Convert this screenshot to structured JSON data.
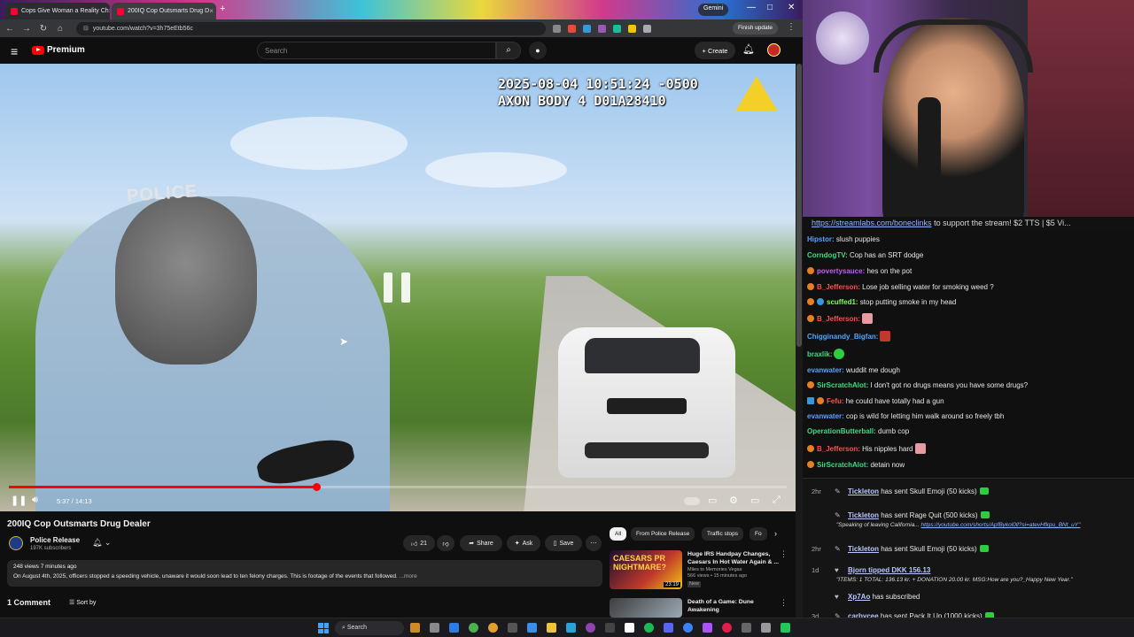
{
  "browser": {
    "tabs": [
      {
        "label": "Cops Give Woman a Reality Ch",
        "close": "×"
      },
      {
        "label": "200IQ Cop Outsmarts Drug D",
        "close": "×"
      }
    ],
    "new_tab": "+",
    "gemini_label": "Gemini",
    "url": "youtube.com/watch?v=3h75eEtb56c",
    "finish_update": "Finish update",
    "window_controls": [
      "—",
      "□",
      "✕"
    ]
  },
  "youtube": {
    "logo_word": "Premium",
    "search_placeholder": "Search",
    "create_label": "+ Create",
    "video": {
      "overlay_line1": "2025-08-04 10:51:24 -0500",
      "overlay_line2": "AXON BODY 4 D01A28410",
      "police_patch": "POLICE",
      "time": "5:37 / 14:13",
      "progress_fraction": 0.395
    },
    "title": "200IQ Cop Outsmarts Drug Dealer",
    "channel": {
      "name": "Police Release",
      "subs": "197K subscribers"
    },
    "actions": {
      "likes": "21",
      "share": "Share",
      "ask": "Ask",
      "save": "Save"
    },
    "description": {
      "meta": "248 views  7 minutes ago",
      "text": "On August 4th, 2025, officers stopped a speeding vehicle, unaware it would soon lead to ten felony charges. This is footage of the events that followed.",
      "more": "...more"
    },
    "comments_count": "1 Comment",
    "sort_by": "Sort by",
    "chips": [
      "All",
      "From Police Release",
      "Traffic stops",
      "Fo"
    ],
    "recommendations": [
      {
        "title": "Huge IRS Handpay Changes, Caesars In Hot Water Again & ...",
        "channel": "Miles to Memories Vegas",
        "meta": "566 views • 15 minutes ago",
        "badge": "New",
        "duration": "23:19",
        "thumb_text": "CAESARS PR NIGHTMARE?"
      },
      {
        "title": "Death of a Game: Dune Awakening",
        "channel": "",
        "meta": "",
        "badge": "",
        "duration": "",
        "thumb_text": ""
      }
    ]
  },
  "stream": {
    "ticker_link": "https://streamlabs.com/boneclinks",
    "ticker_text": " to support the stream! $2 TTS | $5 Vi...",
    "chat": [
      {
        "user": "Hipstor:",
        "text": " slush puppies",
        "color": "#5aa0ff"
      },
      {
        "user": "CorndogTV:",
        "text": " Cop has an SRT dodge",
        "color": "#3ddc84"
      },
      {
        "user": "povertysauce:",
        "text": " hes on the pot",
        "color": "#c45cff"
      },
      {
        "user": "B_Jefferson:",
        "text": " Lose job selling water for smoking weed ?",
        "color": "#ff4d4d"
      },
      {
        "user": "scuffed1:",
        "text": " stop putting smoke in my head",
        "color": "#7cff5a"
      },
      {
        "user": "B_Jefferson:",
        "text": "",
        "color": "#ff4d4d"
      },
      {
        "user": "Chigginandy_Bigfan:",
        "text": "",
        "color": "#4fa8ff"
      },
      {
        "user": "braxlik:",
        "text": "",
        "color": "#3ddc84"
      },
      {
        "user": "evanwater:",
        "text": " wuddit me dough",
        "color": "#5aa0ff"
      },
      {
        "user": "SirScratchAlot:",
        "text": " I don't got no drugs means you have some drugs?",
        "color": "#3ddc84"
      },
      {
        "user": "Fefu:",
        "text": " he could have totally had a gun",
        "color": "#ff4d4d"
      },
      {
        "user": "evanwater:",
        "text": " cop is wild for letting him walk around so freely tbh",
        "color": "#5aa0ff"
      },
      {
        "user": "OperationButterball:",
        "text": " dumb cop",
        "color": "#3ddc84"
      },
      {
        "user": "B_Jefferson:",
        "text": " His nipples hard",
        "color": "#ff4d4d"
      },
      {
        "user": "SirScratchAlot:",
        "text": " detain now",
        "color": "#3ddc84"
      }
    ],
    "events": [
      {
        "ago": "2hr",
        "name": "Tickleton",
        "text": " has sent Skull Emoji (50 kicks)",
        "sub": "",
        "sub_link": ""
      },
      {
        "ago": "",
        "name": "Tickleton",
        "text": " has sent Rage Quit (500 kicks)",
        "sub": "\"Speaking of leaving California... ",
        "sub_link": "https://youtube.com/shorts/ApfBykol0ll?si=atevHfkpu_BNt_uY\""
      },
      {
        "ago": "2hr",
        "name": "Tickleton",
        "text": " has sent Skull Emoji (50 kicks)",
        "sub": "",
        "sub_link": ""
      },
      {
        "ago": "1d",
        "name": "Bjorn tipped DKK 156.13",
        "text": "",
        "sub": "\"ITEMS: 1 TOTAL: 136.13 kr. + DONATION 20.00 kr. MSG:How are you?_Happy New Year.\"",
        "sub_link": ""
      },
      {
        "ago": "1d",
        "name": "Xp7Ao",
        "text": " has subscribed",
        "sub": "",
        "sub_link": ""
      },
      {
        "ago": "3d",
        "name": "carbycee",
        "text": " has sent Pack It Up (1000 kicks)",
        "sub": "",
        "sub_link": ""
      }
    ]
  },
  "taskbar": {
    "search": "Search"
  }
}
